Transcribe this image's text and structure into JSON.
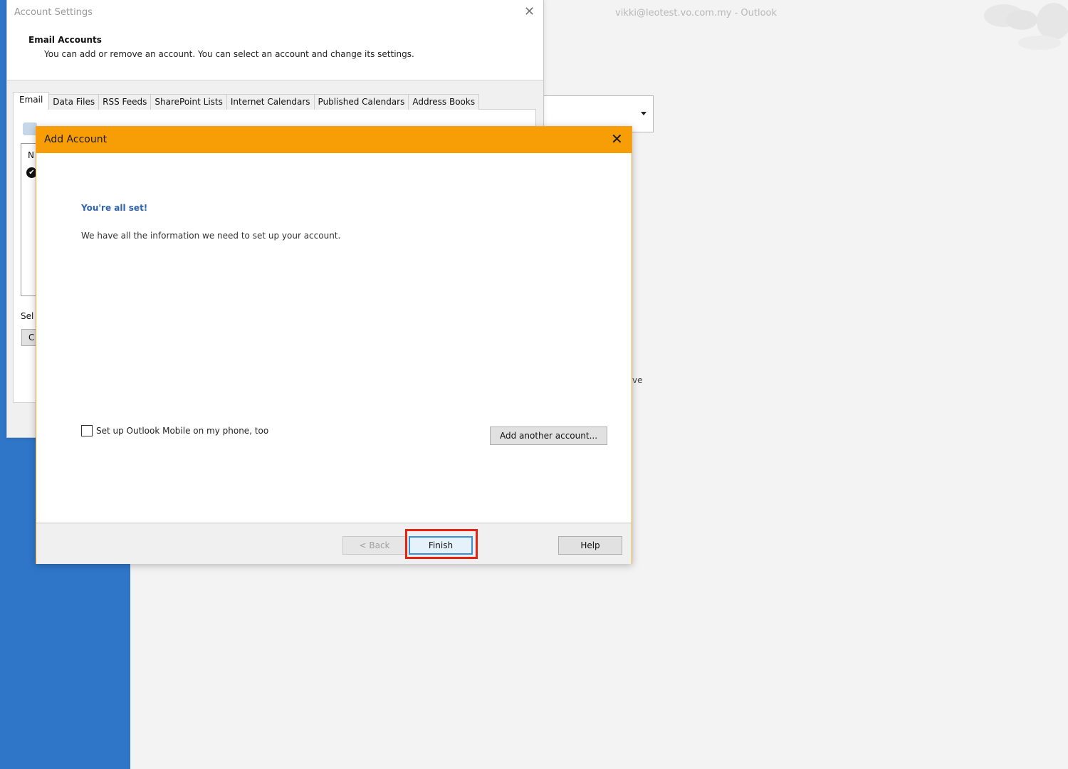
{
  "outlook": {
    "window_title": "vikki@leotest.vo.com.my  -  Outlook",
    "fragment_text": "ve"
  },
  "account_settings": {
    "title": "Account Settings",
    "heading": "Email Accounts",
    "description": "You can add or remove an account. You can select an account and change its settings.",
    "tabs": [
      "Email",
      "Data Files",
      "RSS Feeds",
      "SharePoint Lists",
      "Internet Calendars",
      "Published Calendars",
      "Address Books"
    ],
    "list_header_fragment": "N",
    "select_fragment": "Sel",
    "button_fragment": "C"
  },
  "add_account": {
    "title": "Add Account",
    "all_set": "You're all set!",
    "info": "We have all the information we need to set up your account.",
    "mobile_checkbox_label": "Set up Outlook Mobile on my phone, too",
    "add_another_label": "Add another account...",
    "back_label": "< Back",
    "finish_label": "Finish",
    "help_label": "Help"
  },
  "colors": {
    "titlebar": "#f79d05",
    "sidebar": "#2f76c9",
    "highlight": "#e8220f",
    "heading_blue": "#2f64b4"
  }
}
